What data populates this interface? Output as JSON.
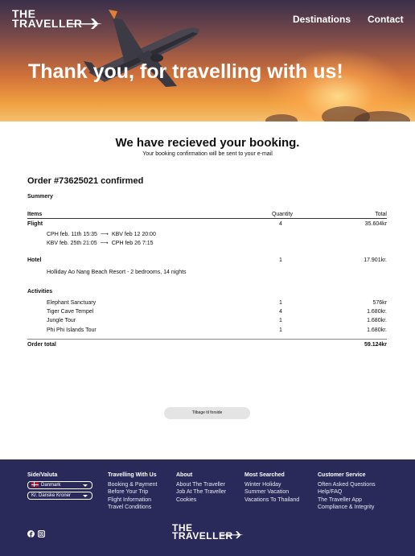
{
  "header": {
    "logo_line1": "THE",
    "logo_line2": "TRAVELLER",
    "nav": [
      "Destinations",
      "Contact"
    ],
    "hero_title": "Thank you, for travelling with us!"
  },
  "confirmation": {
    "heading": "We have recieved your booking.",
    "subheading": "Your booking confirmation will be sent to your e-mail"
  },
  "order": {
    "title": "Order #73625021 confirmed",
    "summary_label": "Summery",
    "columns": [
      "Items",
      "Quantity",
      "Total"
    ],
    "flight": {
      "label": "Flight",
      "quantity": "4",
      "total": "35.604kr",
      "legs": [
        {
          "from": "CPH feb. 11th 15:35",
          "arrow": "⟶",
          "to": "KBV feb 12  20:00"
        },
        {
          "from": "KBV feb. 25th 21:05",
          "arrow": "⟶",
          "to": "CPH feb 26  7:15"
        }
      ]
    },
    "hotel": {
      "label": "Hotel",
      "quantity": "1",
      "total": "17.901kr.",
      "detail": "Holliday Ao Nang Beach Resort - 2 bedrooms, 14 nights"
    },
    "activities": {
      "label": "Activities",
      "items": [
        {
          "name": "Elephant Sanctuary",
          "quantity": "1",
          "total": "576kr"
        },
        {
          "name": "Tiger Cave Tempel",
          "quantity": "4",
          "total": "1.680kr."
        },
        {
          "name": "Jungle Tour",
          "quantity": "1",
          "total": "1.680kr."
        },
        {
          "name": "Phi Phi Islands Tour",
          "quantity": "1",
          "total": "1.680kr."
        }
      ]
    },
    "total_label": "Order total",
    "total_value": "59.124kr",
    "back_button": "Tilbage til forside"
  },
  "footer": {
    "side_valuta": {
      "heading": "Side/Valuta",
      "language": "Danmark",
      "currency": "Kr. Danske Kroner"
    },
    "columns": [
      {
        "heading": "Travelling With Us",
        "links": [
          "Booking & Payment",
          "Before Your Trip",
          "Flight Information",
          "Travel Conditions"
        ]
      },
      {
        "heading": "About",
        "links": [
          "About The Traveller",
          "Job At The Traveller",
          "Cookies"
        ]
      },
      {
        "heading": "Most Searched",
        "links": [
          "Winter Holiday",
          "Summer Vacation",
          "Vacations To Thailand"
        ]
      },
      {
        "heading": "Customer Service",
        "links": [
          "Often Asked Questions",
          "Help/FAQ",
          "The Traveller App",
          "Compliance & Integrity"
        ]
      }
    ],
    "logo_line1": "THE",
    "logo_line2": "TRAVELLER",
    "icons": [
      "facebook-icon",
      "instagram-icon"
    ]
  },
  "colors": {
    "footer_bg": "#292a5a",
    "hero_sunset": "#f0a040"
  }
}
